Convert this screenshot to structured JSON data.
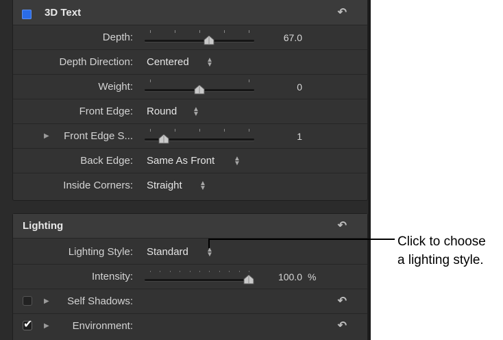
{
  "text3d": {
    "title": "3D Text",
    "depth": {
      "label": "Depth:",
      "value": "67.0",
      "level": 0.6
    },
    "depth_direction": {
      "label": "Depth Direction:",
      "value": "Centered"
    },
    "weight": {
      "label": "Weight:",
      "value": "0",
      "level": 0.5
    },
    "front_edge": {
      "label": "Front Edge:",
      "value": "Round"
    },
    "front_edge_size": {
      "label": "Front Edge S...",
      "value": "1",
      "level": 0.14
    },
    "back_edge": {
      "label": "Back Edge:",
      "value": "Same As Front"
    },
    "inside_corners": {
      "label": "Inside Corners:",
      "value": "Straight"
    }
  },
  "lighting": {
    "title": "Lighting",
    "style": {
      "label": "Lighting Style:",
      "value": "Standard"
    },
    "intensity": {
      "label": "Intensity:",
      "value": "100.0",
      "unit": "%",
      "level": 1.0
    },
    "self_shadows": {
      "label": "Self Shadows:",
      "checked": false
    },
    "environment": {
      "label": "Environment:",
      "checked": true
    }
  },
  "callout": {
    "line1": "Click to choose",
    "line2": "a lighting style."
  },
  "colors": {
    "panel_bg": "#2b2b2b",
    "group_bg": "#333333",
    "header_bg": "#3b3b3b",
    "accent_blue": "#2a6ce8",
    "text": "#d4d4d4"
  },
  "icons": {
    "reset": "reset-arrow-icon",
    "updown": "up-down-chevron-icon",
    "disclosure": "disclosure-triangle-icon",
    "slider_thumb": "slider-thumb-icon",
    "check": "checkmark-icon"
  }
}
